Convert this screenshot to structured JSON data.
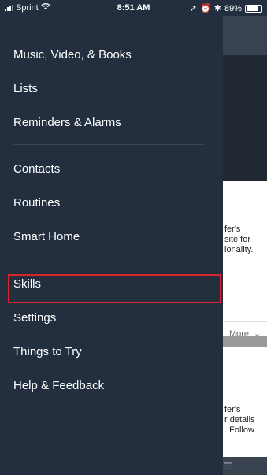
{
  "status_bar": {
    "carrier": "Sprint",
    "time": "8:51 AM",
    "battery": "89%",
    "battery_level": 0.89
  },
  "menu": {
    "items": [
      {
        "label": "Music, Video, & Books"
      },
      {
        "label": "Lists"
      },
      {
        "label": "Reminders & Alarms"
      },
      {
        "label": "Contacts"
      },
      {
        "label": "Routines"
      },
      {
        "label": "Smart Home"
      },
      {
        "label": "Skills"
      },
      {
        "label": "Settings"
      },
      {
        "label": "Things to Try"
      },
      {
        "label": "Help & Feedback"
      }
    ],
    "highlighted": "Skills",
    "highlight_color": "#d9232d"
  },
  "background": {
    "card1_text": "fer's\nsite for\nionality.",
    "more_label": "More",
    "card2_text": "fer's\nr details\n. Follow"
  }
}
